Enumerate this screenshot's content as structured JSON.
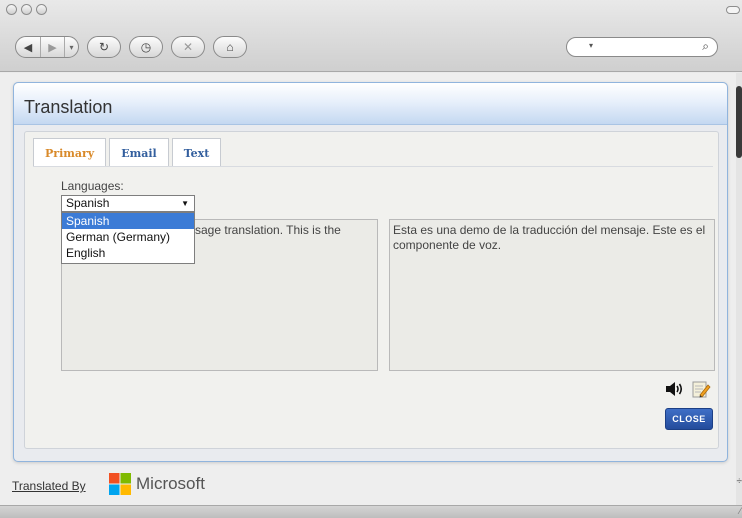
{
  "browser": {
    "nav_icons": [
      "back-icon",
      "forward-icon",
      "reload-icon",
      "history-icon",
      "stop-icon",
      "home-icon"
    ],
    "search_icon": "magnifier-icon"
  },
  "dialog": {
    "title": "Translation",
    "tabs": [
      {
        "label": "Primary",
        "active": true
      },
      {
        "label": "Email",
        "active": false
      },
      {
        "label": "Text",
        "active": false
      }
    ],
    "languages_label": "Languages:",
    "selected_language": "Spanish",
    "language_options": [
      "Spanish",
      "German (Germany)",
      "English"
    ],
    "source_text_visible": "sage translation. This is the",
    "translated_text": "Esta es una demo de la traducción del mensaje. Este es el componente de voz.",
    "close_label": "CLOSE"
  },
  "footer": {
    "translated_by": "Translated By",
    "brand": "Microsoft"
  },
  "colors": {
    "accent_tab": "#d98a2a",
    "tab_text": "#335f9e",
    "close_button": "#2d58ad",
    "dropdown_highlight": "#3b7bd6",
    "ms_red": "#f25022",
    "ms_green": "#7fba00",
    "ms_blue": "#00a4ef",
    "ms_yellow": "#ffb900"
  }
}
